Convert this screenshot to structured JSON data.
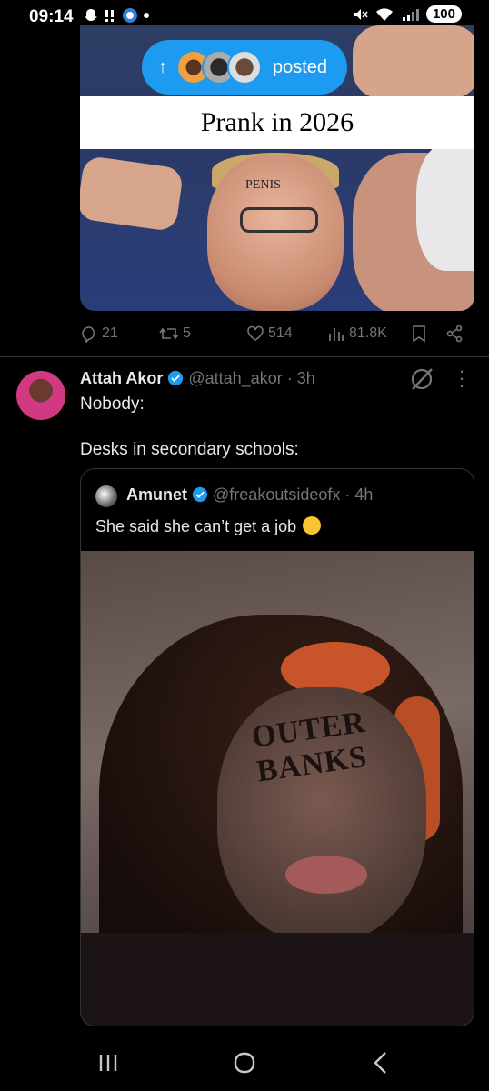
{
  "status_bar": {
    "time": "09:14",
    "battery": "100"
  },
  "posted_pill": {
    "label": "posted"
  },
  "first_post": {
    "image_caption": "Prank in 2026",
    "tattoo_text": "PENIS",
    "actions": {
      "replies": "21",
      "reposts": "5",
      "likes": "514",
      "views": "81.8K"
    }
  },
  "second_post": {
    "author_name": "Attah Akor",
    "author_handle": "@attah_akor",
    "time": "· 3h",
    "line1": "Nobody:",
    "line2": "Desks in secondary schools:",
    "quote": {
      "author_name": "Amunet",
      "author_handle": "@freakoutsideofx",
      "time": "· 4h",
      "text": "She said she can’t get a job",
      "tattoo_text": "OUTER BANKS"
    }
  },
  "colors": {
    "accent": "#1d9bf0",
    "muted": "#71767b",
    "background": "#000000"
  }
}
